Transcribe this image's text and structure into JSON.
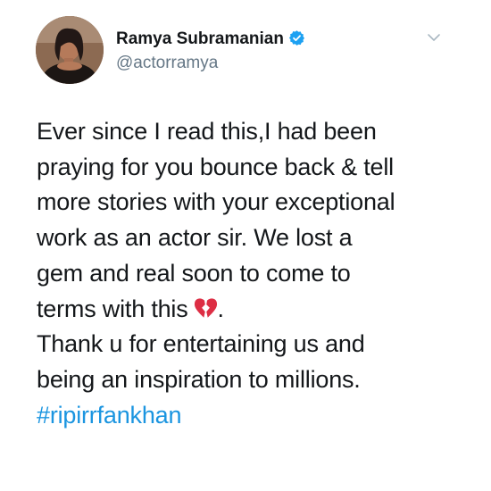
{
  "author": {
    "display_name": "Ramya Subramanian",
    "handle": "@actorramya",
    "verified": true
  },
  "tweet": {
    "lines": [
      "Ever since I read this,I had been",
      "praying for you bounce back & tell",
      "more stories with your exceptional",
      "work as an actor sir. We lost a",
      "gem and real soon to come to",
      "terms with this",
      "Thank u for entertaining us and",
      "being an inspiration to millions."
    ],
    "emoji_suffix": ".",
    "hashtag": "#ripirrfankhan"
  },
  "icons": {
    "verified": "verified-badge-icon",
    "menu": "chevron-down-icon",
    "emoji": "broken-heart-icon"
  },
  "colors": {
    "text": "#14171a",
    "secondary": "#657786",
    "link": "#1b95e0",
    "verified": "#1da1f2",
    "emoji": "#dd2e44"
  }
}
